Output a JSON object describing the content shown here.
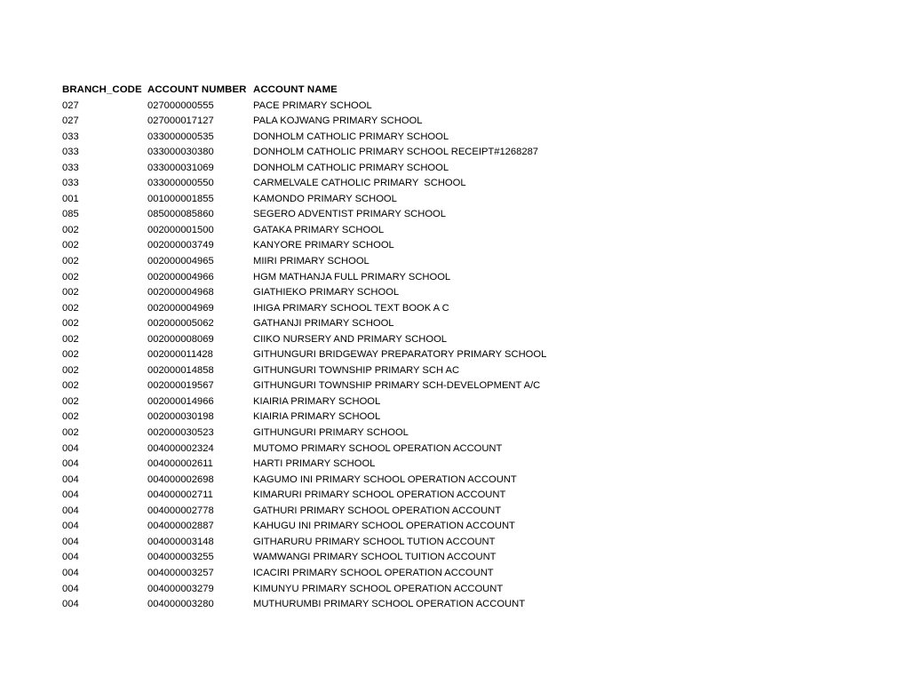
{
  "document": {
    "table": {
      "columns": [
        {
          "key": "branch_code",
          "label": "BRANCH_CODE"
        },
        {
          "key": "account_number",
          "label": "ACCOUNT NUMBER"
        },
        {
          "key": "account_name",
          "label": "ACCOUNT NAME"
        }
      ],
      "rows": [
        {
          "branch_code": "027",
          "account_number": "027000000555",
          "account_name": "PACE PRIMARY SCHOOL"
        },
        {
          "branch_code": "027",
          "account_number": "027000017127",
          "account_name": "PALA KOJWANG PRIMARY SCHOOL"
        },
        {
          "branch_code": "033",
          "account_number": "033000000535",
          "account_name": "DONHOLM CATHOLIC PRIMARY SCHOOL"
        },
        {
          "branch_code": "033",
          "account_number": "033000030380",
          "account_name": "DONHOLM CATHOLIC PRIMARY SCHOOL RECEIPT#1268287"
        },
        {
          "branch_code": "033",
          "account_number": "033000031069",
          "account_name": "DONHOLM CATHOLIC PRIMARY SCHOOL"
        },
        {
          "branch_code": "033",
          "account_number": "033000000550",
          "account_name": "CARMELVALE CATHOLIC PRIMARY  SCHOOL"
        },
        {
          "branch_code": "001",
          "account_number": "001000001855",
          "account_name": "KAMONDO PRIMARY SCHOOL"
        },
        {
          "branch_code": "085",
          "account_number": "085000085860",
          "account_name": "SEGERO ADVENTIST PRIMARY SCHOOL"
        },
        {
          "branch_code": "002",
          "account_number": "002000001500",
          "account_name": "GATAKA PRIMARY SCHOOL"
        },
        {
          "branch_code": "002",
          "account_number": "002000003749",
          "account_name": "KANYORE PRIMARY SCHOOL"
        },
        {
          "branch_code": "002",
          "account_number": "002000004965",
          "account_name": "MIIRI PRIMARY SCHOOL"
        },
        {
          "branch_code": "002",
          "account_number": "002000004966",
          "account_name": "HGM MATHANJA FULL PRIMARY SCHOOL"
        },
        {
          "branch_code": "002",
          "account_number": "002000004968",
          "account_name": "GIATHIEKO PRIMARY SCHOOL"
        },
        {
          "branch_code": "002",
          "account_number": "002000004969",
          "account_name": "IHIGA PRIMARY SCHOOL TEXT BOOK A C"
        },
        {
          "branch_code": "002",
          "account_number": "002000005062",
          "account_name": "GATHANJI PRIMARY SCHOOL"
        },
        {
          "branch_code": "002",
          "account_number": "002000008069",
          "account_name": "CIIKO NURSERY AND PRIMARY SCHOOL"
        },
        {
          "branch_code": "002",
          "account_number": "002000011428",
          "account_name": "GITHUNGURI BRIDGEWAY PREPARATORY PRIMARY SCHOOL"
        },
        {
          "branch_code": "002",
          "account_number": "002000014858",
          "account_name": "GITHUNGURI TOWNSHIP PRIMARY SCH AC"
        },
        {
          "branch_code": "002",
          "account_number": "002000019567",
          "account_name": "GITHUNGURI TOWNSHIP PRIMARY SCH-DEVELOPMENT A/C"
        },
        {
          "branch_code": "002",
          "account_number": "002000014966",
          "account_name": "KIAIRIA PRIMARY SCHOOL"
        },
        {
          "branch_code": "002",
          "account_number": "002000030198",
          "account_name": "KIAIRIA PRIMARY SCHOOL"
        },
        {
          "branch_code": "002",
          "account_number": "002000030523",
          "account_name": "GITHUNGURI PRIMARY SCHOOL"
        },
        {
          "branch_code": "004",
          "account_number": "004000002324",
          "account_name": "MUTOMO PRIMARY SCHOOL OPERATION ACCOUNT"
        },
        {
          "branch_code": "004",
          "account_number": "004000002611",
          "account_name": "HARTI PRIMARY SCHOOL"
        },
        {
          "branch_code": "004",
          "account_number": "004000002698",
          "account_name": "KAGUMO INI PRIMARY SCHOOL OPERATION ACCOUNT"
        },
        {
          "branch_code": "004",
          "account_number": "004000002711",
          "account_name": "KIMARURI PRIMARY SCHOOL OPERATION ACCOUNT"
        },
        {
          "branch_code": "004",
          "account_number": "004000002778",
          "account_name": "GATHURI PRIMARY SCHOOL OPERATION ACCOUNT"
        },
        {
          "branch_code": "004",
          "account_number": "004000002887",
          "account_name": "KAHUGU INI PRIMARY SCHOOL OPERATION ACCOUNT"
        },
        {
          "branch_code": "004",
          "account_number": "004000003148",
          "account_name": "GITHARURU PRIMARY SCHOOL TUTION ACCOUNT"
        },
        {
          "branch_code": "004",
          "account_number": "004000003255",
          "account_name": "WAMWANGI PRIMARY SCHOOL TUITION ACCOUNT"
        },
        {
          "branch_code": "004",
          "account_number": "004000003257",
          "account_name": "ICACIRI PRIMARY SCHOOL OPERATION ACCOUNT"
        },
        {
          "branch_code": "004",
          "account_number": "004000003279",
          "account_name": "KIMUNYU PRIMARY SCHOOL OPERATION ACCOUNT"
        },
        {
          "branch_code": "004",
          "account_number": "004000003280",
          "account_name": "MUTHURUMBI PRIMARY SCHOOL OPERATION ACCOUNT"
        }
      ]
    }
  }
}
